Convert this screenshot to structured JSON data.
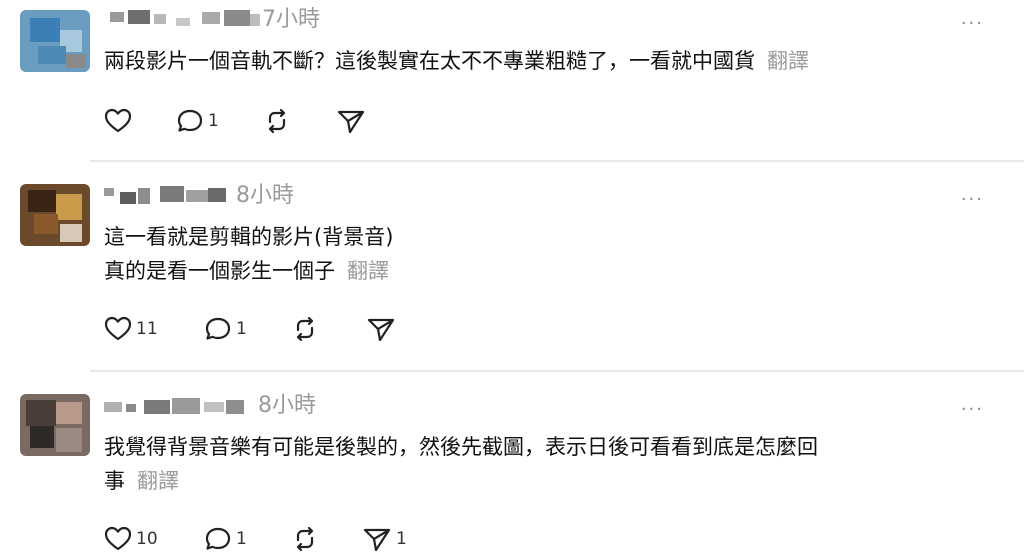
{
  "posts": [
    {
      "time": "7小時",
      "text": "兩段影片一個音軌不斷？這後製實在太不不專業粗糙了，一看就中國貨",
      "translate": "翻譯",
      "more": "···",
      "likes": "",
      "replies": "1",
      "reposts": "",
      "shares": ""
    },
    {
      "time": "8小時",
      "text_line1": "這一看就是剪輯的影片(背景音)",
      "text_line2": "真的是看一個影生一個子",
      "translate": "翻譯",
      "more": "···",
      "likes": "11",
      "replies": "1",
      "reposts": "",
      "shares": ""
    },
    {
      "time": "8小時",
      "text_line1": "我覺得背景音樂有可能是後製的，然後先截圖，表示日後可看看到底是怎麼回",
      "text_line2": "事",
      "translate": "翻譯",
      "more": "···",
      "likes": "10",
      "replies": "1",
      "reposts": "",
      "shares": "1"
    }
  ],
  "icons": {
    "like": "heart-icon",
    "reply": "comment-icon",
    "repost": "repost-icon",
    "share": "send-icon"
  }
}
